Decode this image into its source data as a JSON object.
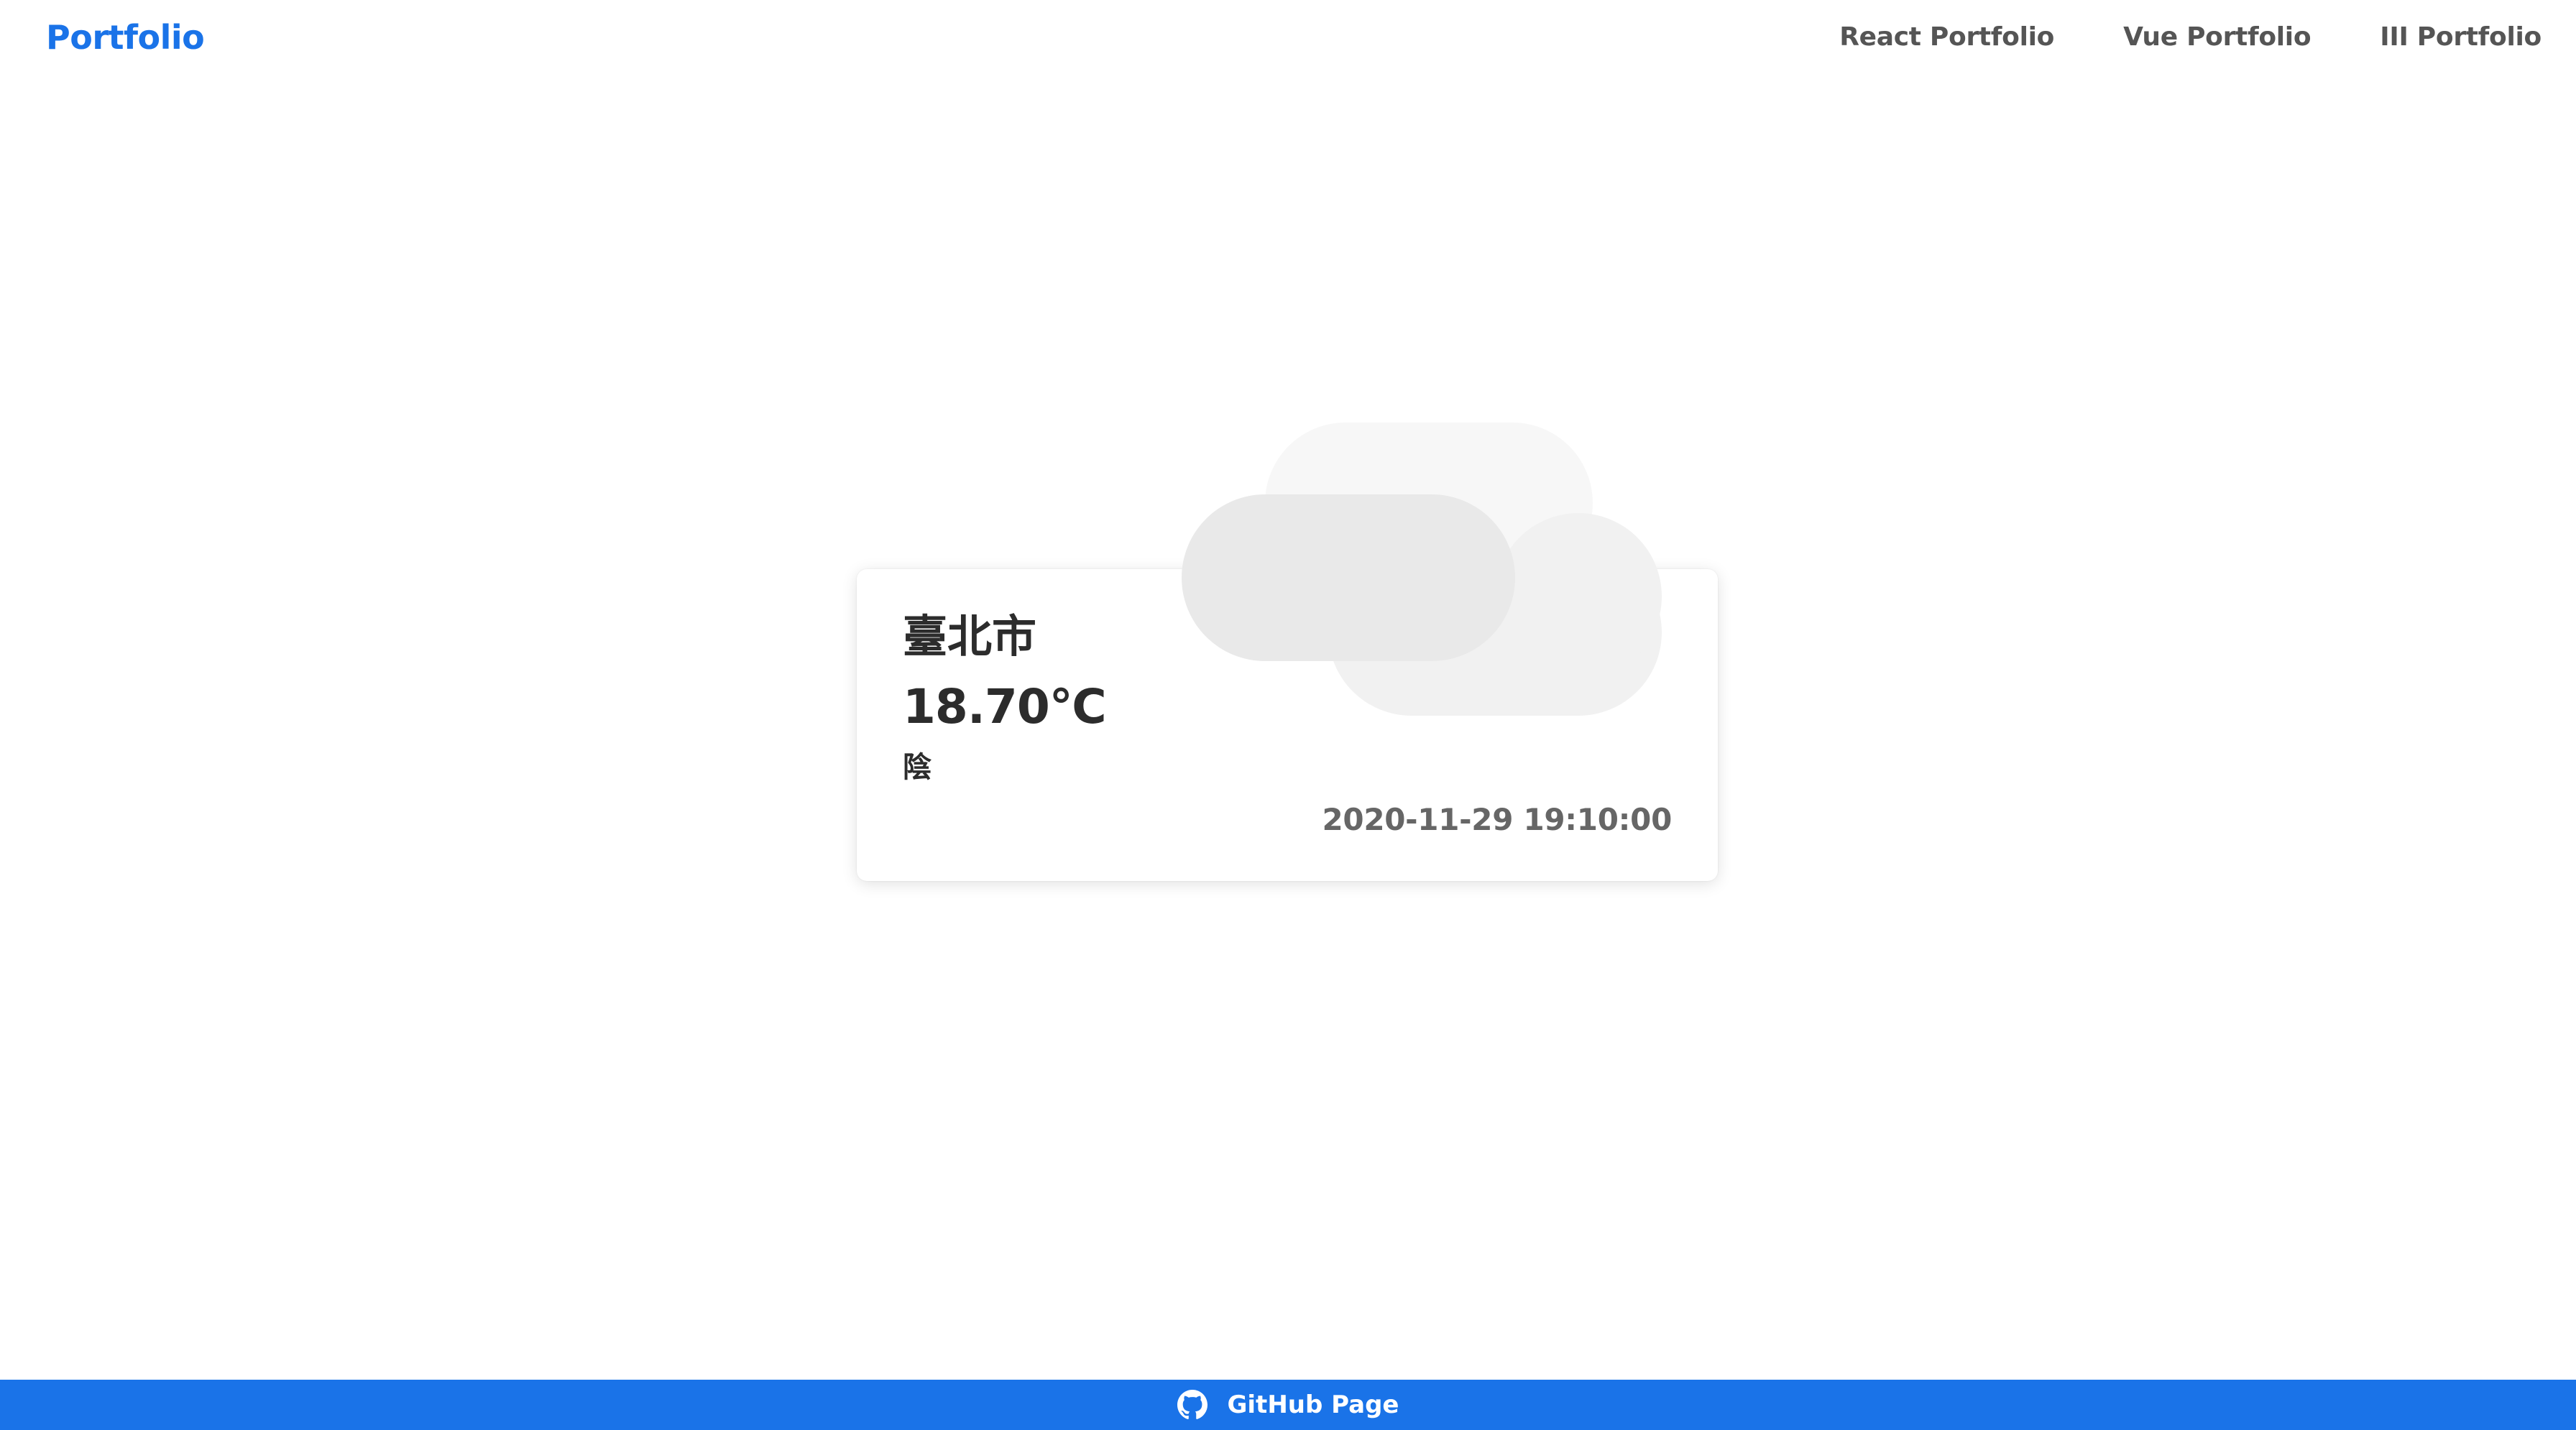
{
  "header": {
    "brand": "Portfolio",
    "nav": [
      {
        "label": "React Portfolio"
      },
      {
        "label": "Vue Portfolio"
      },
      {
        "label": "III Portfolio"
      }
    ]
  },
  "weather": {
    "city": "臺北市",
    "temperature": "18.70℃",
    "description": "陰",
    "observed_time": "2020-11-29 19:10:00",
    "icon": "cloud-icon"
  },
  "footer": {
    "link_label": "GitHub Page",
    "icon": "github-icon"
  },
  "colors": {
    "accent": "#1a73e8",
    "nav_text": "#555555",
    "primary_text": "#2c2c2c",
    "secondary_text": "#666666"
  }
}
